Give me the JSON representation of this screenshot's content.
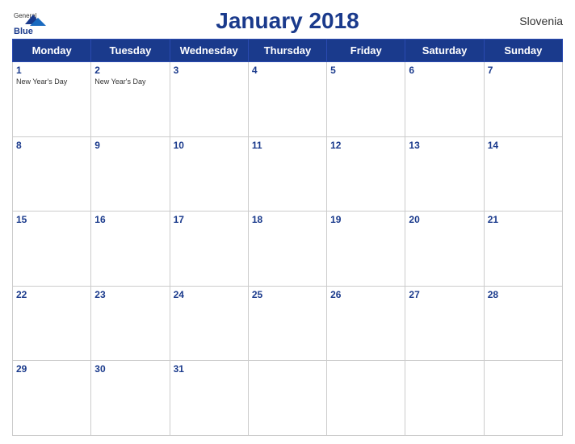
{
  "header": {
    "title": "January 2018",
    "country": "Slovenia",
    "logo": {
      "general": "General",
      "blue": "Blue"
    }
  },
  "days_of_week": [
    "Monday",
    "Tuesday",
    "Wednesday",
    "Thursday",
    "Friday",
    "Saturday",
    "Sunday"
  ],
  "weeks": [
    [
      {
        "day": 1,
        "holiday": "New Year's Day"
      },
      {
        "day": 2,
        "holiday": "New Year's Day"
      },
      {
        "day": 3,
        "holiday": ""
      },
      {
        "day": 4,
        "holiday": ""
      },
      {
        "day": 5,
        "holiday": ""
      },
      {
        "day": 6,
        "holiday": ""
      },
      {
        "day": 7,
        "holiday": ""
      }
    ],
    [
      {
        "day": 8,
        "holiday": ""
      },
      {
        "day": 9,
        "holiday": ""
      },
      {
        "day": 10,
        "holiday": ""
      },
      {
        "day": 11,
        "holiday": ""
      },
      {
        "day": 12,
        "holiday": ""
      },
      {
        "day": 13,
        "holiday": ""
      },
      {
        "day": 14,
        "holiday": ""
      }
    ],
    [
      {
        "day": 15,
        "holiday": ""
      },
      {
        "day": 16,
        "holiday": ""
      },
      {
        "day": 17,
        "holiday": ""
      },
      {
        "day": 18,
        "holiday": ""
      },
      {
        "day": 19,
        "holiday": ""
      },
      {
        "day": 20,
        "holiday": ""
      },
      {
        "day": 21,
        "holiday": ""
      }
    ],
    [
      {
        "day": 22,
        "holiday": ""
      },
      {
        "day": 23,
        "holiday": ""
      },
      {
        "day": 24,
        "holiday": ""
      },
      {
        "day": 25,
        "holiday": ""
      },
      {
        "day": 26,
        "holiday": ""
      },
      {
        "day": 27,
        "holiday": ""
      },
      {
        "day": 28,
        "holiday": ""
      }
    ],
    [
      {
        "day": 29,
        "holiday": ""
      },
      {
        "day": 30,
        "holiday": ""
      },
      {
        "day": 31,
        "holiday": ""
      },
      {
        "day": null,
        "holiday": ""
      },
      {
        "day": null,
        "holiday": ""
      },
      {
        "day": null,
        "holiday": ""
      },
      {
        "day": null,
        "holiday": ""
      }
    ]
  ]
}
